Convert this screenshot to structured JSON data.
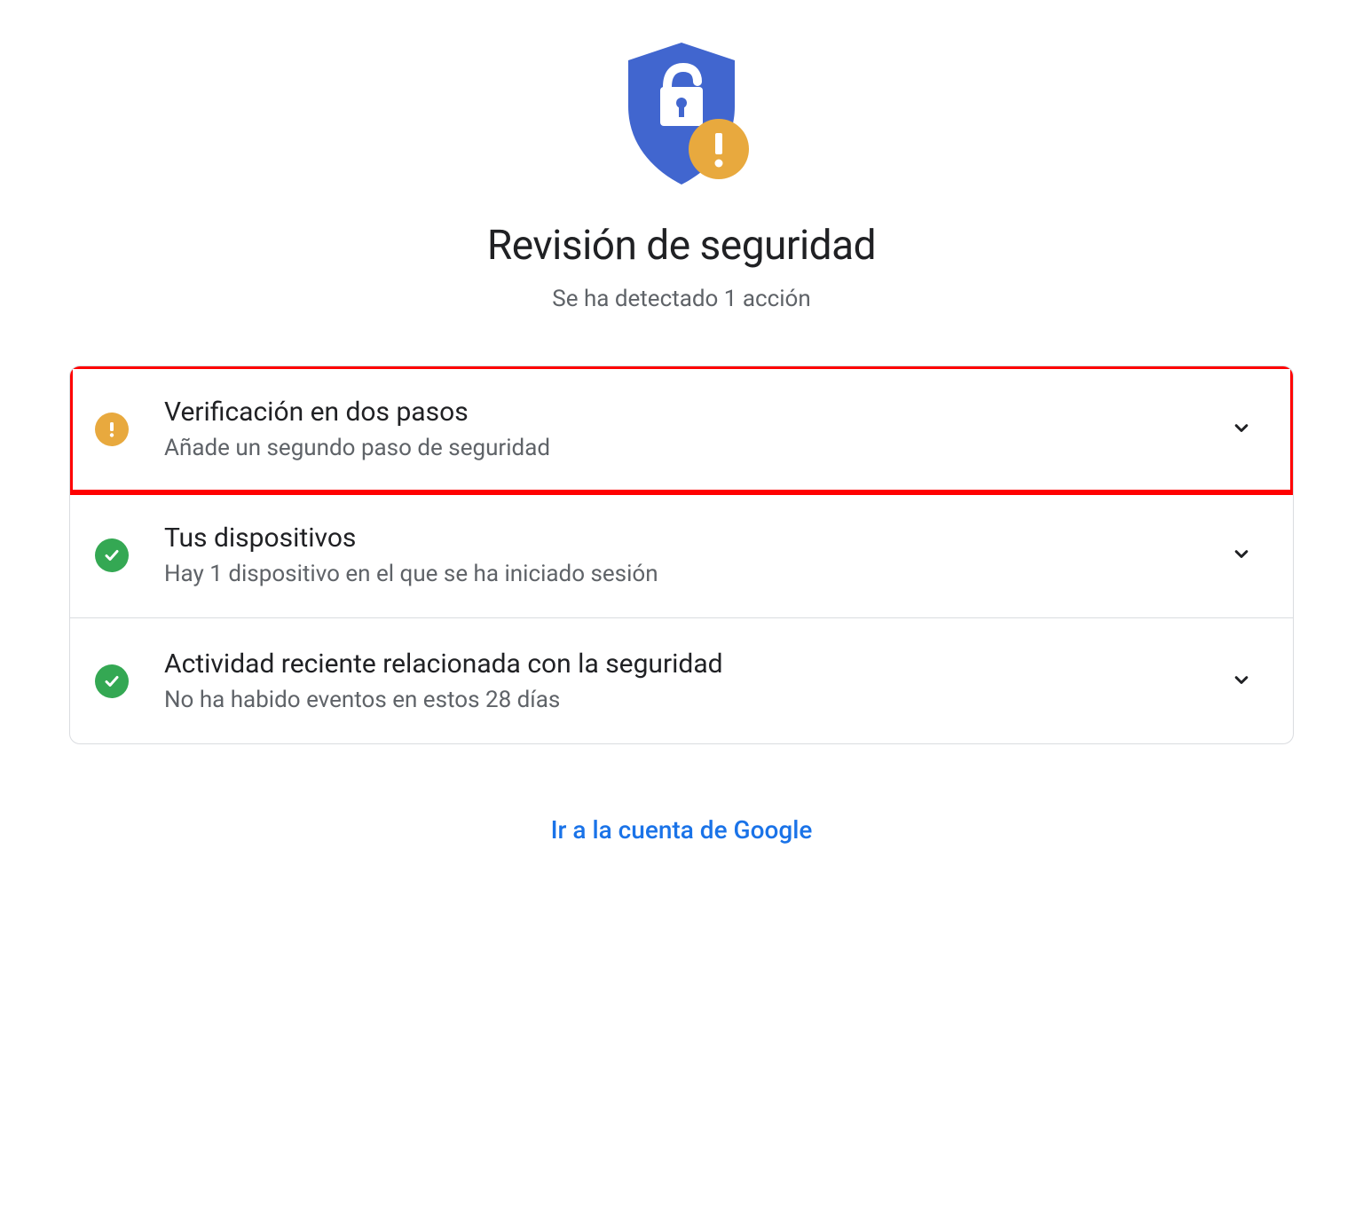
{
  "header": {
    "title": "Revisión de seguridad",
    "subtitle": "Se ha detectado 1 acción"
  },
  "items": [
    {
      "status": "warning",
      "title": "Verificación en dos pasos",
      "subtitle": "Añade un segundo paso de seguridad",
      "highlighted": true
    },
    {
      "status": "ok",
      "title": "Tus dispositivos",
      "subtitle": "Hay 1 dispositivo en el que se ha iniciado sesión",
      "highlighted": false
    },
    {
      "status": "ok",
      "title": "Actividad reciente relacionada con la seguridad",
      "subtitle": "No ha habido eventos en estos 28 días",
      "highlighted": false
    }
  ],
  "footer": {
    "link_label": "Ir a la cuenta de Google"
  },
  "colors": {
    "blue": "#4166cf",
    "yellow": "#e8a93e",
    "green": "#34a853",
    "link": "#1a73e8"
  }
}
